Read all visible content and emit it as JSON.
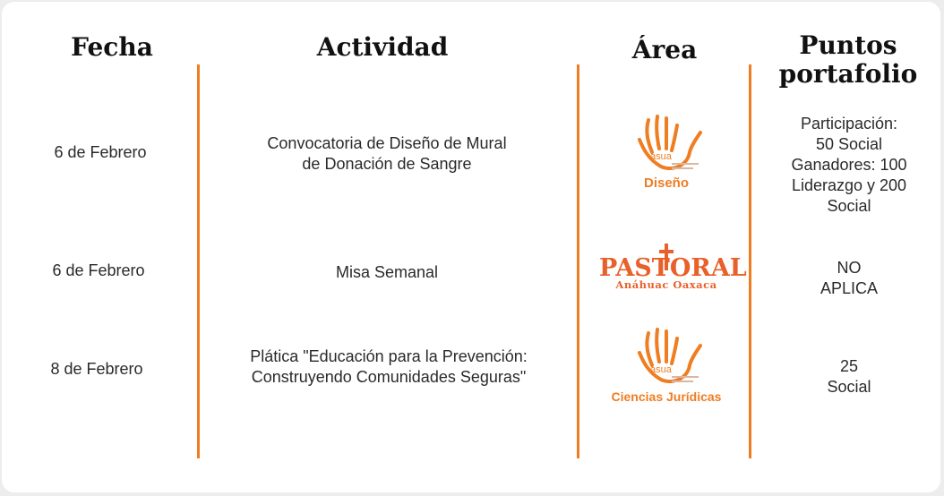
{
  "headers": {
    "fecha": "Fecha",
    "actividad": "Actividad",
    "area": "Área",
    "puntos_line1": "Puntos",
    "puntos_line2": "portafolio"
  },
  "rows": [
    {
      "fecha": "6 de Febrero",
      "actividad_line1": "Convocatoria de Diseño de Mural",
      "actividad_line2": "de Donación de Sangre",
      "area_logo": "asua",
      "area_label": "Diseño",
      "puntos": [
        "Participación:",
        "50 Social",
        "Ganadores: 100",
        "Liderazgo y 200",
        "Social"
      ]
    },
    {
      "fecha": "6 de Febrero",
      "actividad_line1": "Misa Semanal",
      "area_logo": "pastoral",
      "area_label": "PASTORAL",
      "area_sublabel": "Anáhuac Oaxaca",
      "puntos": [
        "NO",
        "APLICA"
      ]
    },
    {
      "fecha": "8 de Febrero",
      "actividad_line1": "Plática \"Educación para la Prevención:",
      "actividad_line2": "Construyendo Comunidades Seguras\"",
      "area_logo": "asua",
      "area_label": "Ciencias Jurídicas",
      "puntos": [
        "25",
        "Social"
      ]
    }
  ],
  "logo_text": {
    "asua": "asua"
  },
  "colors": {
    "accent": "#ef7d22",
    "pastoral": "#e8602a"
  }
}
